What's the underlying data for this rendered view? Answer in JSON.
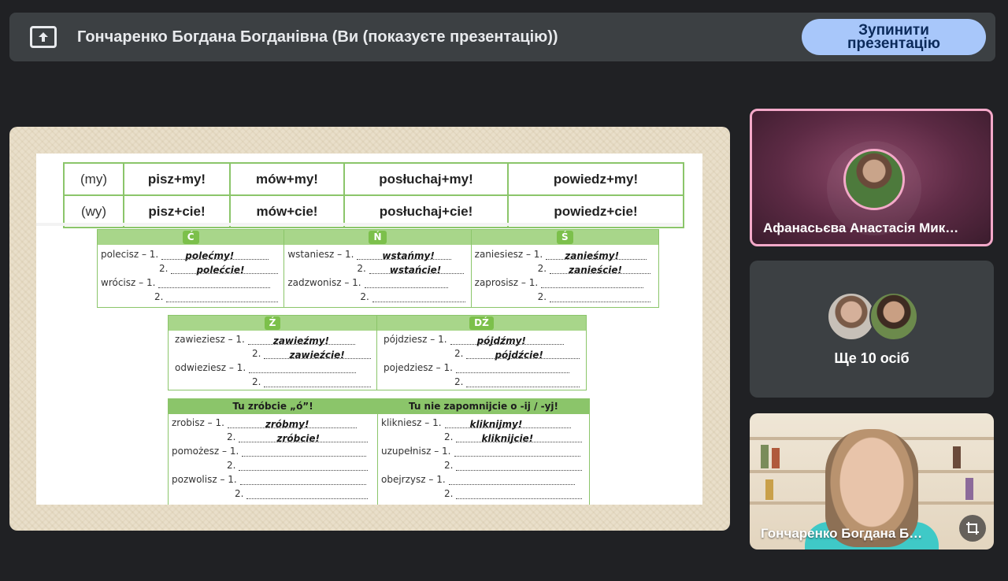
{
  "top_bar": {
    "icon": "present-screen-icon",
    "title": "Гончаренко Богдана Богданівна (Ви (показуєте презентацію))",
    "stop_button_line1": "Зупинити",
    "stop_button_line2": "презентацію"
  },
  "slide": {
    "top_table": {
      "rows": [
        {
          "pron": "(my)",
          "cells": [
            "pisz+my!",
            "mów+my!",
            "posłuchaj+my!",
            "powiedz+my!"
          ]
        },
        {
          "pron": "(wy)",
          "cells": [
            "pisz+cie!",
            "mów+cie!",
            "posłuchaj+cie!",
            "powiedz+cie!"
          ]
        }
      ]
    },
    "group1": [
      {
        "tag": "Ć",
        "items": [
          {
            "verb": "polecisz – 1.",
            "ans1": "polećmy!",
            "ans2": "polećcie!"
          },
          {
            "verb": "wrócisz – 1.",
            "ans1": "",
            "ans2": ""
          }
        ]
      },
      {
        "tag": "Ń",
        "items": [
          {
            "verb": "wstaniesz – 1.",
            "ans1": "wstańmy!",
            "ans2": "wstańcie!"
          },
          {
            "verb": "zadzwonisz – 1.",
            "ans1": "",
            "ans2": ""
          }
        ]
      },
      {
        "tag": "Ś",
        "items": [
          {
            "verb": "zaniesiesz – 1.",
            "ans1": "zanieśmy!",
            "ans2": "zanieście!"
          },
          {
            "verb": "zaprosisz – 1.",
            "ans1": "",
            "ans2": ""
          }
        ]
      }
    ],
    "group2": [
      {
        "tag": "Ź",
        "items": [
          {
            "verb": "zawieziesz – 1.",
            "ans1": "zawieźmy!",
            "ans2": "zawieźcie!"
          },
          {
            "verb": "odwieziesz – 1.",
            "ans1": "",
            "ans2": ""
          }
        ]
      },
      {
        "tag": "DŹ",
        "items": [
          {
            "verb": "pójdziesz – 1.",
            "ans1": "pójdźmy!",
            "ans2": "pójdźcie!"
          },
          {
            "verb": "pojedziesz – 1.",
            "ans1": "",
            "ans2": ""
          }
        ]
      }
    ],
    "group3": [
      {
        "header": "Tu zróbcie „ó”!",
        "items": [
          {
            "verb": "zrobisz – 1.",
            "ans1": "zróbmy!",
            "ans2": "zróbcie!"
          },
          {
            "verb": "pomożesz – 1.",
            "ans1": "",
            "ans2": ""
          },
          {
            "verb": "pozwolisz – 1.",
            "ans1": "",
            "ans2": ""
          }
        ]
      },
      {
        "header": "Tu nie zapomnijcie o -ij / -yj!",
        "items": [
          {
            "verb": "klikniesz – 1.",
            "ans1": "kliknijmy!",
            "ans2": "kliknijcie!"
          },
          {
            "verb": "uzupełnisz – 1.",
            "ans1": "",
            "ans2": ""
          },
          {
            "verb": "obejrzysz – 1.",
            "ans1": "",
            "ans2": ""
          }
        ]
      }
    ],
    "num2": "2."
  },
  "participants": {
    "tile1_name": "Афанасьєва Анастасія Мик…",
    "tile2_more": "Ще 10 осіб",
    "tile3_name": "Гончаренко Богдана Б…",
    "active_speaker_color": "#f4a9c9"
  }
}
